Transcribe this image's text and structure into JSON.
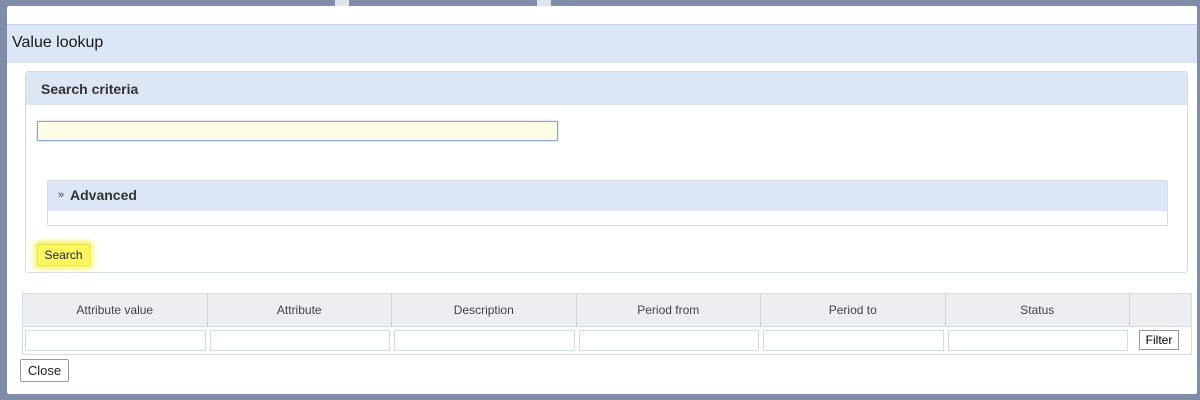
{
  "dialog": {
    "title": "Value lookup",
    "close_icon": "close-icon"
  },
  "search_criteria": {
    "title": "Search criteria",
    "input_value": "",
    "advanced": {
      "icon": "double-chevron-down-icon",
      "label": "Advanced"
    },
    "search_label": "Search"
  },
  "results": {
    "columns": [
      "Attribute value",
      "Attribute",
      "Description",
      "Period from",
      "Period to",
      "Status"
    ],
    "filter_label": "Filter"
  },
  "footer": {
    "close_label": "Close"
  }
}
